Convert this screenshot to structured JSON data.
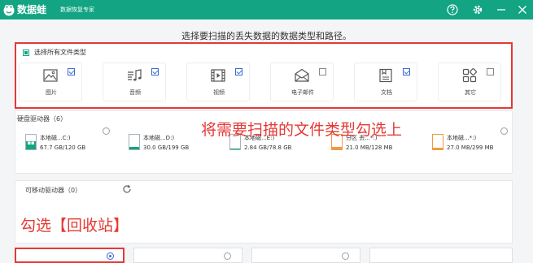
{
  "app": {
    "name": "数据蛙",
    "subtitle": "数据恢复专家",
    "colors": {
      "brand": "#12a483",
      "annotation": "#e53935",
      "accent": "#3a6ad1"
    }
  },
  "window_controls": [
    "help-icon",
    "settings-icon",
    "minimize-icon",
    "close-icon"
  ],
  "instruction": "选择要扫描的丢失数据的数据类型和路径。",
  "file_types": {
    "select_all_label": "选择所有文件类型",
    "items": [
      {
        "label": "图片",
        "icon": "image-icon",
        "checked": true
      },
      {
        "label": "音频",
        "icon": "music-icon",
        "checked": true
      },
      {
        "label": "视频",
        "icon": "video-icon",
        "checked": true
      },
      {
        "label": "电子邮件",
        "icon": "email-icon",
        "checked": false
      },
      {
        "label": "文档",
        "icon": "document-icon",
        "checked": true
      },
      {
        "label": "其它",
        "icon": "other-icon",
        "checked": false
      }
    ]
  },
  "hard_drives": {
    "title": "硬盘驱动器（6）",
    "drives": [
      {
        "name": "本地磁...C:)",
        "size": "67.7 GB/120 GB",
        "used_fraction": 0.56,
        "system": true,
        "selected": false
      },
      {
        "name": "本地磁...D:)",
        "size": "30.0 GB/199 GB",
        "used_fraction": 0.15,
        "system": false,
        "selected": false
      },
      {
        "name": "本地磁...E:)",
        "size": "2.84 GB/78.8 GB",
        "used_fraction": 0.04,
        "system": false,
        "selected": false
      },
      {
        "name": "分区 丢...*:)",
        "size": "21.0 MB/128 MB",
        "used_fraction": 0.16,
        "system": false,
        "selected": false
      },
      {
        "name": "本地磁...*:)",
        "size": "27.0 MB/299 MB",
        "used_fraction": 0.09,
        "system": false,
        "selected": false
      }
    ]
  },
  "removable": {
    "title": "可移动驱动器（0）",
    "refresh_icon": "refresh-icon"
  },
  "annotations": {
    "check_types": "将需要扫描的文件类型勾选上",
    "check_recycle": "勾选【回收站】"
  }
}
